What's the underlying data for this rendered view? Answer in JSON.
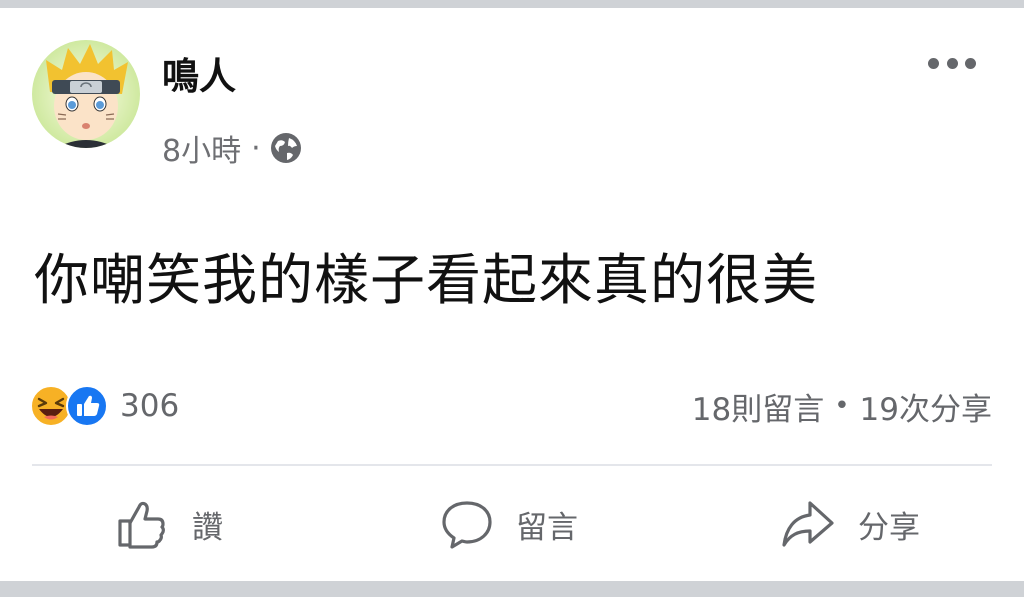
{
  "post": {
    "author": "鳴人",
    "time": "8小時",
    "separator": "·",
    "privacy_icon": "globe-icon",
    "more_icon": "more-options-icon",
    "text": "你嘲笑我的樣子看起來真的很美"
  },
  "stats": {
    "reaction_icons": [
      "haha-reaction-icon",
      "like-reaction-icon"
    ],
    "reaction_count": "306",
    "comments": "18則留言",
    "dot": "•",
    "shares": "19次分享"
  },
  "actions": {
    "like_label": "讚",
    "comment_label": "留言",
    "share_label": "分享"
  },
  "colors": {
    "text": "#111111",
    "muted": "#65676b",
    "like_blue": "#1877f2",
    "haha_yellow": "#f7b125",
    "divider": "#e4e6eb",
    "band": "#cfd2d6"
  }
}
